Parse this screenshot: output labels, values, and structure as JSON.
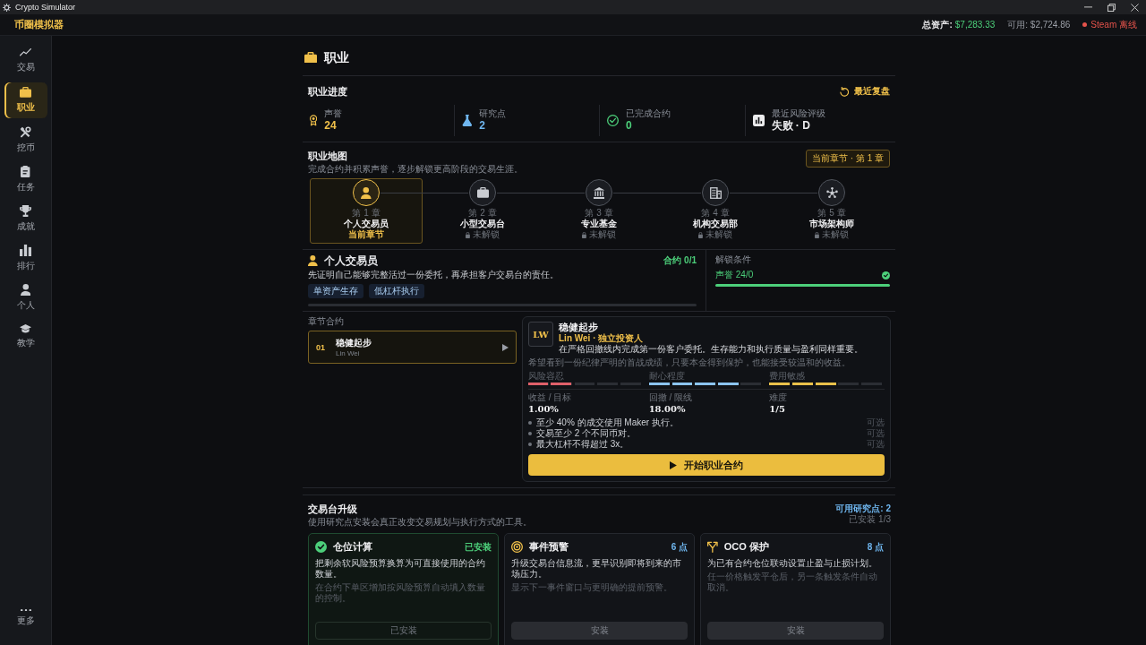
{
  "window": {
    "title": "Crypto Simulator"
  },
  "header": {
    "app_name": "币圈模拟器",
    "total_assets": {
      "label": "总资产:",
      "value": "$7,283.33"
    },
    "available": "可用: $2,724.86",
    "steam_status": "Steam 离线",
    "steam_online": false
  },
  "sidebar": {
    "items": [
      {
        "label": "交易",
        "selected": false
      },
      {
        "label": "职业",
        "selected": true
      },
      {
        "label": "挖币",
        "selected": false
      },
      {
        "label": "任务",
        "selected": false
      },
      {
        "label": "成就",
        "selected": false
      },
      {
        "label": "排行",
        "selected": false
      },
      {
        "label": "个人",
        "selected": false
      },
      {
        "label": "教学",
        "selected": false
      }
    ],
    "more": "更多"
  },
  "page": {
    "title": "职业"
  },
  "progress": {
    "title": "职业进度",
    "review_button": "最近复盘",
    "stats": [
      {
        "label": "声誉",
        "value": "24",
        "color": "#f0c04a"
      },
      {
        "label": "研究点",
        "value": "2",
        "color": "#6fb6ef"
      },
      {
        "label": "已完成合约",
        "value": "0",
        "color": "#4ccf7a"
      },
      {
        "label": "最近风险评级",
        "value": "失败 · D",
        "color": "#ececee"
      }
    ]
  },
  "career_map": {
    "title": "职业地图",
    "subtitle": "完成合约并积累声誉，逐步解锁更高阶段的交易生涯。",
    "current_badge": "当前章节 · 第 1 章",
    "chapters": [
      {
        "number": "第 1 章",
        "name": "个人交易员",
        "status": "当前章节",
        "selected": true,
        "locked": false
      },
      {
        "number": "第 2 章",
        "name": "小型交易台",
        "status": "未解锁",
        "selected": false,
        "locked": true
      },
      {
        "number": "第 3 章",
        "name": "专业基金",
        "status": "未解锁",
        "selected": false,
        "locked": true
      },
      {
        "number": "第 4 章",
        "name": "机构交易部",
        "status": "未解锁",
        "selected": false,
        "locked": true
      },
      {
        "number": "第 5 章",
        "name": "市场架构师",
        "status": "未解锁",
        "selected": false,
        "locked": true
      }
    ]
  },
  "chapter_detail": {
    "title": "个人交易员",
    "contracts_count": "合约 0/1",
    "description": "先证明自己能够完整活过一份委托，再承担客户交易台的责任。",
    "tags": [
      "单资产生存",
      "低杠杆执行"
    ],
    "unlock": {
      "label": "解锁条件",
      "requirements": [
        {
          "text": "声誉 24/0",
          "met": true
        }
      ]
    }
  },
  "contracts": {
    "label": "章节合约",
    "items": [
      {
        "index": "01",
        "title": "稳健起步",
        "client": "Lin Wei",
        "selected": true
      }
    ]
  },
  "contract_detail": {
    "avatar": "LW",
    "title": "稳健起步",
    "client": "Lin Wei · 独立投资人",
    "description": "在严格回撤线内完成第一份客户委托。生存能力和执行质量与盈利同样重要。",
    "quote": "希望看到一份纪律严明的首战成绩，只要本金得到保护，也能接受较温和的收益。",
    "traits": [
      {
        "label": "风险容忍",
        "level": 0.4,
        "color": "#e0606a"
      },
      {
        "label": "耐心程度",
        "level": 0.8,
        "color": "#8cc4f0"
      },
      {
        "label": "费用敏感",
        "level": 0.6,
        "color": "#e9c04a"
      }
    ],
    "stats": [
      {
        "label": "收益 / 目标",
        "value": "1.00%"
      },
      {
        "label": "回撤 / 限线",
        "value": "18.00%"
      },
      {
        "label": "难度",
        "value": "1/5"
      }
    ],
    "objectives": [
      {
        "text": "至少 40% 的成交使用 Maker 执行。",
        "tag": "可选"
      },
      {
        "text": "交易至少 2 个不同币对。",
        "tag": "可选"
      },
      {
        "text": "最大杠杆不得超过 3x。",
        "tag": "可选"
      }
    ],
    "start_button": "开始职业合约"
  },
  "upgrades": {
    "title": "交易台升级",
    "subtitle": "使用研究点安装会真正改变交易规划与执行方式的工具。",
    "available_points": "可用研究点: 2",
    "installed_count": "已安装 1/3",
    "items": [
      {
        "name": "仓位计算",
        "badge": "已安装",
        "installed": true,
        "description": "把剩余软风险预算换算为可直接使用的合约数量。",
        "detail": "在合约下单区增加按风险预算自动填入数量的控制。",
        "button": "已安装"
      },
      {
        "name": "事件预警",
        "badge": "6 点",
        "installed": false,
        "description": "升级交易台信息流，更早识别即将到来的市场压力。",
        "detail": "显示下一事件窗口与更明确的提前预警。",
        "button": "安装"
      },
      {
        "name": "OCO 保护",
        "badge": "8 点",
        "installed": false,
        "description": "为已有合约仓位联动设置止盈与止损计划。",
        "detail": "任一价格触发平仓后，另一条触发条件自动取消。",
        "button": "安装"
      }
    ]
  }
}
